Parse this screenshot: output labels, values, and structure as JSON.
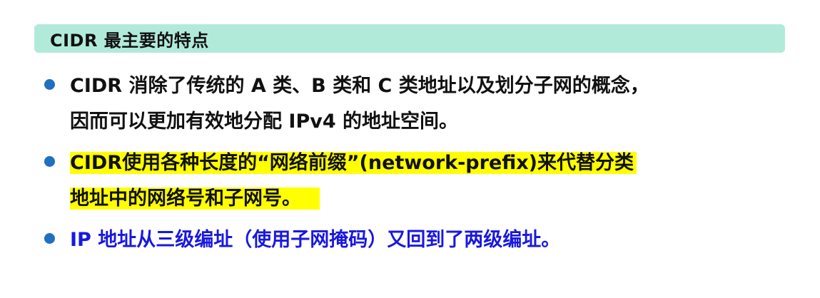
{
  "title": "CIDR 最主要的特点",
  "colors": {
    "title_background": "#b2ead9",
    "bullet": "#1f6fc2",
    "highlight": "#ffff00",
    "blue_text": "#1818e0",
    "text": "#111111"
  },
  "bullets": [
    {
      "lines": [
        "CIDR 消除了传统的 A 类、B 类和 C 类地址以及划分子网的概念，",
        "因而可以更加有效地分配 IPv4 的地址空间。"
      ]
    },
    {
      "lines": [
        "CIDR使用各种长度的“网络前缀”(network-prefix)来代替分类",
        "地址中的网络号和子网号。"
      ],
      "highlighted": true
    },
    {
      "lines": [
        "IP 地址从三级编址（使用子网掩码）又回到了两级编址。"
      ],
      "color": "blue"
    }
  ]
}
